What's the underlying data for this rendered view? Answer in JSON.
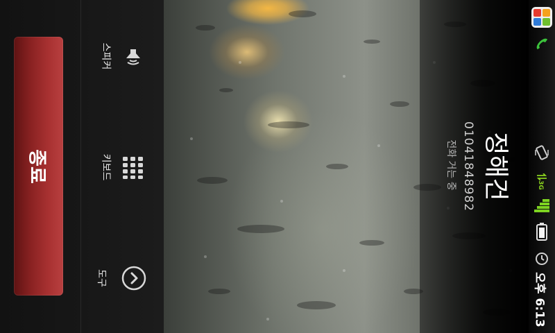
{
  "call": {
    "contact_name": "정해건",
    "phone_number": "01041848982",
    "status": "전화 거는 중"
  },
  "actions": {
    "end_label": "종료",
    "speaker_label": "스피커",
    "keypad_label": "키보드",
    "tools_label": "도구"
  },
  "status_bar": {
    "network_type": "3G",
    "time": "오후 6:13",
    "icons": [
      "app-launcher-icon",
      "active-call-icon",
      "vibrate-icon",
      "data-activity-icon",
      "signal-icon",
      "battery-icon",
      "alarm-icon"
    ],
    "accent_color": "#7dd321"
  },
  "colors": {
    "end_button": "#a83131",
    "panel_bg": "#1a1a1a"
  }
}
